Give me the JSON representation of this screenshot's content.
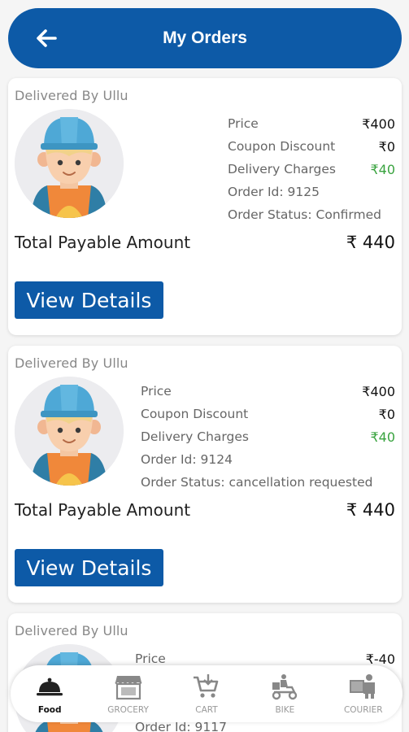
{
  "header": {
    "title": "My Orders"
  },
  "orders": [
    {
      "delivered_by": "Delivered By Ullu",
      "price_label": "Price",
      "price": "₹400",
      "coupon_label": "Coupon Discount",
      "coupon": "₹0",
      "delivery_label": "Delivery Charges",
      "delivery": "₹40",
      "order_id": "Order Id: 9125",
      "status": "Order Status: Confirmed",
      "total_label": "Total Payable Amount",
      "total": "₹ 440",
      "button": "View Details"
    },
    {
      "delivered_by": "Delivered By Ullu",
      "price_label": "Price",
      "price": "₹400",
      "coupon_label": "Coupon Discount",
      "coupon": "₹0",
      "delivery_label": "Delivery Charges",
      "delivery": "₹40",
      "order_id": "Order Id: 9124",
      "status": "Order Status: cancellation requested",
      "total_label": "Total Payable Amount",
      "total": "₹ 440",
      "button": "View Details"
    },
    {
      "delivered_by": "Delivered By Ullu",
      "price_label": "Price",
      "price": "₹-40",
      "order_id": "Order Id: 9117"
    }
  ],
  "nav": {
    "items": [
      {
        "label": "Food",
        "icon": "cloche-icon",
        "active": true
      },
      {
        "label": "GROCERY",
        "icon": "store-icon"
      },
      {
        "label": "CART",
        "icon": "cart-icon"
      },
      {
        "label": "BIKE",
        "icon": "bike-delivery-icon"
      },
      {
        "label": "COURIER",
        "icon": "courier-icon"
      }
    ]
  },
  "colors": {
    "primary": "#0d5aa7",
    "green": "#39a33f",
    "background": "#f5f5f5"
  }
}
